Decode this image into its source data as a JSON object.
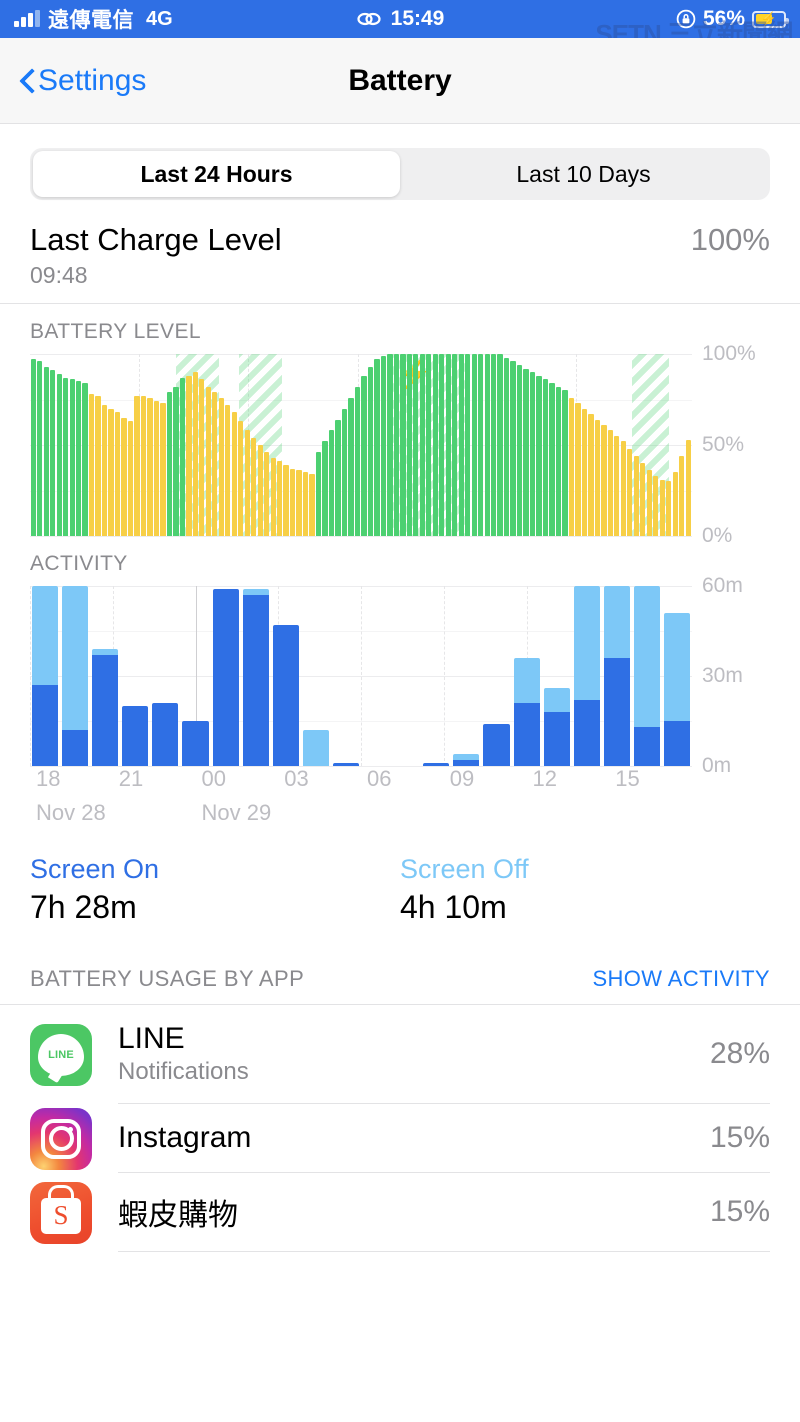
{
  "statusbar": {
    "carrier": "遠傳電信",
    "network": "4G",
    "time": "15:49",
    "battery_percent": "56%",
    "link_icon": "chain-link-icon",
    "watermark": "SETN 三立新聞網"
  },
  "navbar": {
    "back_label": "Settings",
    "title": "Battery"
  },
  "segmented": {
    "options": [
      "Last 24 Hours",
      "Last 10 Days"
    ],
    "selected_index": 0
  },
  "last_charge": {
    "title": "Last Charge Level",
    "time": "09:48",
    "percent": "100%"
  },
  "screen_stats": {
    "on_label": "Screen On",
    "on_value": "7h 28m",
    "off_label": "Screen Off",
    "off_value": "4h 10m"
  },
  "usage_header": {
    "title": "BATTERY USAGE BY APP",
    "action": "SHOW ACTIVITY"
  },
  "apps": [
    {
      "name": "LINE",
      "subtitle": "Notifications",
      "percent": "28%",
      "icon": "line-app-icon",
      "icon_glyph": "LINE"
    },
    {
      "name": "Instagram",
      "subtitle": "",
      "percent": "15%",
      "icon": "instagram-app-icon",
      "icon_glyph": ""
    },
    {
      "name": "蝦皮購物",
      "subtitle": "",
      "percent": "15%",
      "icon": "shopee-app-icon",
      "icon_glyph": "S"
    }
  ],
  "colors": {
    "accent_blue": "#1a7af8",
    "status_bar_blue": "#2f6fe4",
    "battery_green": "#4cd071",
    "battery_yellow": "#f7cf46",
    "screen_on_blue": "#2f6fe4",
    "screen_off_blue": "#7dc8f7",
    "muted_gray": "#8a8a8e"
  },
  "chart_data": [
    {
      "type": "bar",
      "title": "BATTERY LEVEL",
      "xlabel": "",
      "ylabel": "",
      "ylim": [
        0,
        100
      ],
      "yticks": [
        "0%",
        "50%",
        "100%"
      ],
      "grid": true,
      "legend": "none",
      "series_note": "green = charging/high power mode off, yellow = low power mode",
      "values": [
        97,
        96,
        93,
        91,
        89,
        87,
        86,
        85,
        84,
        78,
        77,
        72,
        70,
        68,
        65,
        63,
        77,
        77,
        76,
        74,
        73,
        79,
        82,
        87,
        88,
        90,
        86,
        82,
        79,
        76,
        72,
        68,
        63,
        58,
        54,
        50,
        46,
        43,
        41,
        39,
        37,
        36,
        35,
        34,
        46,
        52,
        58,
        64,
        70,
        76,
        82,
        88,
        93,
        97,
        99,
        100,
        100,
        100,
        100,
        100,
        100,
        100,
        100,
        100,
        100,
        100,
        100,
        100,
        100,
        100,
        100,
        100,
        100,
        98,
        96,
        94,
        92,
        90,
        88,
        86,
        84,
        82,
        80,
        76,
        73,
        70,
        67,
        64,
        61,
        58,
        55,
        52,
        48,
        44,
        40,
        36,
        33,
        31,
        30,
        35,
        44,
        53
      ],
      "colors": [
        "green",
        "green",
        "green",
        "green",
        "green",
        "green",
        "green",
        "green",
        "green",
        "yellow",
        "yellow",
        "yellow",
        "yellow",
        "yellow",
        "yellow",
        "yellow",
        "yellow",
        "yellow",
        "yellow",
        "yellow",
        "yellow",
        "green",
        "green",
        "green",
        "yellow",
        "yellow",
        "yellow",
        "yellow",
        "yellow",
        "yellow",
        "yellow",
        "yellow",
        "yellow",
        "yellow",
        "yellow",
        "yellow",
        "yellow",
        "yellow",
        "yellow",
        "yellow",
        "yellow",
        "yellow",
        "yellow",
        "yellow",
        "green",
        "green",
        "green",
        "green",
        "green",
        "green",
        "green",
        "green",
        "green",
        "green",
        "green",
        "green",
        "green",
        "green",
        "green",
        "green",
        "green",
        "green",
        "green",
        "green",
        "green",
        "green",
        "green",
        "green",
        "green",
        "green",
        "green",
        "green",
        "green",
        "green",
        "green",
        "green",
        "green",
        "green",
        "green",
        "green",
        "green",
        "green",
        "green",
        "yellow",
        "yellow",
        "yellow",
        "yellow",
        "yellow",
        "yellow",
        "yellow",
        "yellow",
        "yellow",
        "yellow",
        "yellow",
        "yellow",
        "yellow",
        "yellow",
        "yellow",
        "yellow",
        "yellow",
        "yellow",
        "yellow"
      ],
      "charging_bands": [
        {
          "start_pct": 22.0,
          "end_pct": 28.5,
          "bolt": false
        },
        {
          "start_pct": 31.5,
          "end_pct": 38.0,
          "bolt": false
        },
        {
          "start_pct": 54.0,
          "end_pct": 66.5,
          "bolt": true
        },
        {
          "start_pct": 91.0,
          "end_pct": 96.5,
          "bolt": false
        }
      ]
    },
    {
      "type": "bar",
      "title": "ACTIVITY",
      "xlabel": "",
      "ylabel": "",
      "ylim": [
        0,
        60
      ],
      "yticks": [
        "0m",
        "30m",
        "60m"
      ],
      "xticks": [
        "18",
        "21",
        "00",
        "03",
        "06",
        "09",
        "12",
        "15"
      ],
      "day_labels": [
        "Nov 28",
        "Nov 29"
      ],
      "grid": true,
      "stacked": true,
      "series": [
        {
          "name": "Screen On",
          "color": "#2f6fe4",
          "values": [
            27,
            12,
            37,
            20,
            21,
            15,
            59,
            57,
            47,
            0,
            1,
            0,
            0,
            1,
            2,
            14,
            21,
            18,
            22,
            36,
            13,
            15
          ]
        },
        {
          "name": "Screen Off",
          "color": "#7dc8f7",
          "values": [
            33,
            48,
            2,
            0,
            0,
            0,
            0,
            2,
            0,
            12,
            0,
            0,
            0,
            0,
            2,
            0,
            15,
            8,
            38,
            24,
            47,
            36
          ]
        }
      ]
    }
  ]
}
